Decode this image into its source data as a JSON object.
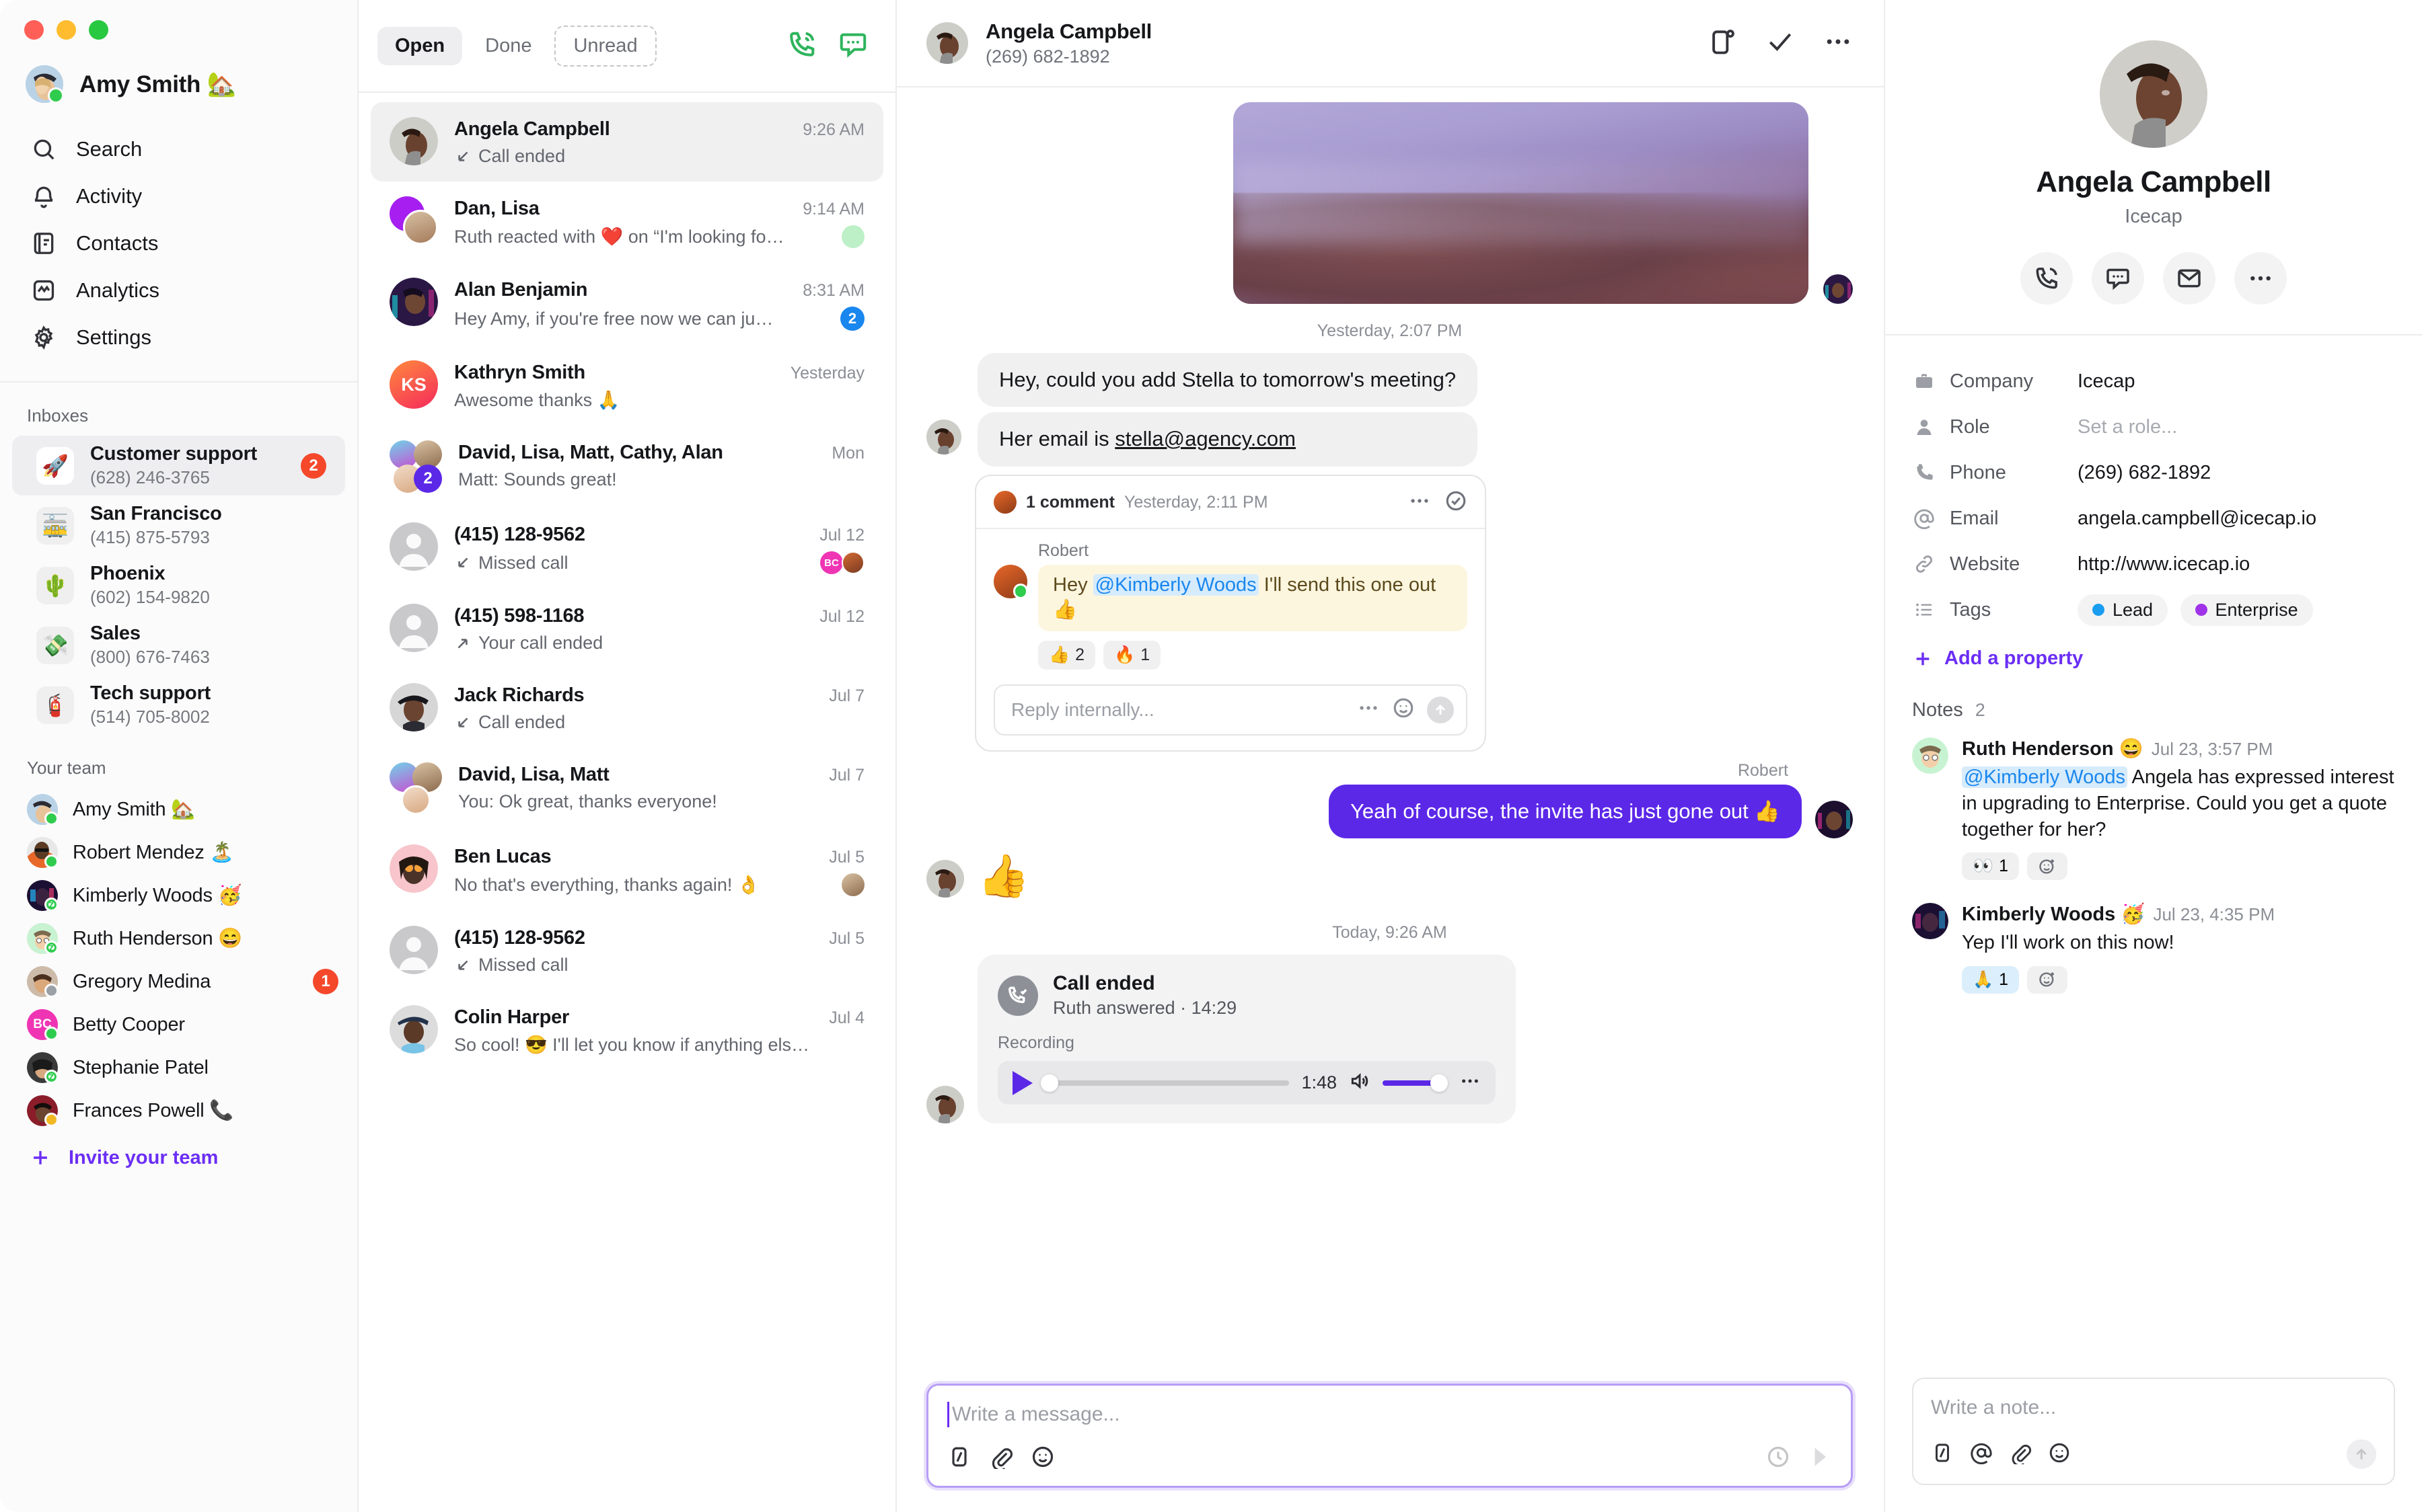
{
  "window": {
    "traffic_lights": [
      "close",
      "minimize",
      "maximize"
    ]
  },
  "nav": {
    "user": {
      "name": "Amy Smith",
      "emoji": "🏡",
      "presence": "online"
    },
    "items": [
      {
        "label": "Search",
        "icon": "search-icon"
      },
      {
        "label": "Activity",
        "icon": "bell-icon"
      },
      {
        "label": "Contacts",
        "icon": "contacts-book-icon"
      },
      {
        "label": "Analytics",
        "icon": "analytics-icon"
      },
      {
        "label": "Settings",
        "icon": "gear-icon"
      }
    ],
    "inboxes_title": "Inboxes",
    "inboxes": [
      {
        "name": "Customer support",
        "phone": "(628) 246-3765",
        "emoji": "🚀",
        "badge": "2",
        "selected": true
      },
      {
        "name": "San Francisco",
        "phone": "(415) 875-5793",
        "emoji": "🚋",
        "badge": "",
        "selected": false
      },
      {
        "name": "Phoenix",
        "phone": "(602) 154-9820",
        "emoji": "🌵",
        "badge": "",
        "selected": false
      },
      {
        "name": "Sales",
        "phone": "(800) 676-7463",
        "emoji": "💸",
        "badge": "",
        "selected": false
      },
      {
        "name": "Tech support",
        "phone": "(514) 705-8002",
        "emoji": "🧯",
        "badge": "",
        "selected": false
      }
    ],
    "team_title": "Your team",
    "team": [
      {
        "name": "Amy Smith",
        "emoji": "🏡",
        "presence": "online",
        "badge": ""
      },
      {
        "name": "Robert Mendez",
        "emoji": "🏝️",
        "presence": "online",
        "badge": ""
      },
      {
        "name": "Kimberly Woods",
        "emoji": "🥳",
        "presence": "snooze",
        "badge": ""
      },
      {
        "name": "Ruth Henderson",
        "emoji": "😄",
        "presence": "snooze",
        "badge": ""
      },
      {
        "name": "Gregory Medina",
        "emoji": "",
        "presence": "dnd",
        "badge": "1"
      },
      {
        "name": "Betty Cooper",
        "emoji": "",
        "presence": "online",
        "badge": "",
        "initials": "BC"
      },
      {
        "name": "Stephanie Patel",
        "emoji": "",
        "presence": "snooze",
        "badge": ""
      },
      {
        "name": "Frances Powell",
        "emoji": "📞",
        "presence": "away",
        "badge": ""
      }
    ],
    "invite_label": "Invite your team"
  },
  "conversation_list": {
    "tabs": [
      {
        "label": "Open",
        "active": true
      },
      {
        "label": "Done",
        "active": false
      },
      {
        "label": "Unread",
        "active": false,
        "dashed": true
      }
    ],
    "actions": [
      {
        "name": "new-call-icon"
      },
      {
        "name": "new-message-icon"
      }
    ],
    "items": [
      {
        "name": "Angela Campbell",
        "time": "9:26 AM",
        "preview": "Call ended",
        "call": "in",
        "selected": true,
        "badge": "",
        "avatar_type": "photo-angela"
      },
      {
        "name": "Dan, Lisa",
        "time": "9:14 AM",
        "preview": "Ruth reacted with ❤️ on “I'm looking fo…",
        "call": "",
        "selected": false,
        "badge": "",
        "avatar_type": "group2-dan-lisa",
        "trailing_avatar": true
      },
      {
        "name": "Alan Benjamin",
        "time": "8:31 AM",
        "preview": "Hey Amy, if you're free now we can ju…",
        "call": "",
        "selected": false,
        "badge": "2",
        "avatar_type": "photo-alan"
      },
      {
        "name": "Kathryn Smith",
        "time": "Yesterday",
        "preview": "Awesome thanks 🙏",
        "call": "",
        "selected": false,
        "badge": "",
        "avatar_type": "initials-KS"
      },
      {
        "name": "David, Lisa, Matt, Cathy, Alan",
        "time": "Mon",
        "preview": "Matt: Sounds great!",
        "call": "",
        "selected": false,
        "badge": "",
        "avatar_type": "group4-plus2",
        "group_count": "2"
      },
      {
        "name": "(415) 128-9562",
        "time": "Jul 12",
        "preview": "Missed call",
        "call": "in",
        "selected": false,
        "badge": "",
        "avatar_type": "anon",
        "trailing_stack": true
      },
      {
        "name": "(415) 598-1168",
        "time": "Jul 12",
        "preview": "Your call ended",
        "call": "out",
        "selected": false,
        "badge": "",
        "avatar_type": "anon"
      },
      {
        "name": "Jack Richards",
        "time": "Jul 7",
        "preview": "Call ended",
        "call": "in",
        "selected": false,
        "badge": "",
        "avatar_type": "photo-jack"
      },
      {
        "name": "David, Lisa, Matt",
        "time": "Jul 7",
        "preview": "You: Ok great, thanks everyone!",
        "call": "",
        "selected": false,
        "badge": "",
        "avatar_type": "group3"
      },
      {
        "name": "Ben Lucas",
        "time": "Jul 5",
        "preview": "No that's everything, thanks again! 👌",
        "call": "",
        "selected": false,
        "badge": "",
        "avatar_type": "memoji-ben",
        "trailing_avatar": true
      },
      {
        "name": "(415) 128-9562",
        "time": "Jul 5",
        "preview": "Missed call",
        "call": "in",
        "selected": false,
        "badge": "",
        "avatar_type": "anon"
      },
      {
        "name": "Colin Harper",
        "time": "Jul 4",
        "preview": "So cool! 😎 I'll let you know if anything els…",
        "call": "",
        "selected": false,
        "badge": "",
        "avatar_type": "photo-colin"
      }
    ]
  },
  "thread": {
    "header": {
      "name": "Angela Campbell",
      "phone": "(269) 682-1892",
      "actions": [
        "contact-card-icon",
        "mark-done-icon",
        "more-icon"
      ]
    },
    "image_message": {
      "alt": "purple misty mountains photo"
    },
    "separators": {
      "first": "Yesterday, 2:07 PM",
      "second": "Today, 9:26 AM"
    },
    "messages": [
      {
        "dir": "in",
        "text": "Hey, could you add Stella to tomorrow's meeting?"
      },
      {
        "dir": "in",
        "text": "Her email is ",
        "link": "stella@agency.com"
      }
    ],
    "comment": {
      "count_label": "1 comment",
      "time": "Yesterday, 2:11 PM",
      "author": "Robert",
      "text_pre": "Hey ",
      "mention": "@Kimberly Woods",
      "text_post": " I'll send this one out 👍",
      "reactions": [
        {
          "emoji": "👍",
          "count": "2"
        },
        {
          "emoji": "🔥",
          "count": "1"
        }
      ],
      "reply_placeholder": "Reply internally..."
    },
    "outgoing": {
      "sender": "Robert",
      "text": "Yeah of course, the invite has just gone out 👍"
    },
    "reaction_message": {
      "emoji": "👍"
    },
    "call_card": {
      "title": "Call ended",
      "subtitle": "Ruth answered · 14:29",
      "recording_label": "Recording",
      "duration": "1:48",
      "progress_percent": 0,
      "volume_percent": 82
    },
    "composer": {
      "placeholder": "Write a message...",
      "tools": [
        "snippet-icon",
        "attachment-icon",
        "emoji-icon"
      ],
      "right_tools": [
        "schedule-clock-icon",
        "send-icon"
      ]
    }
  },
  "right_panel": {
    "name": "Angela Campbell",
    "company_sub": "Icecap",
    "actions": [
      "call-icon",
      "message-icon",
      "email-icon",
      "more-icon"
    ],
    "properties": [
      {
        "icon": "briefcase-icon",
        "label": "Company",
        "value": "Icecap",
        "muted": false
      },
      {
        "icon": "person-icon",
        "label": "Role",
        "value": "Set a role...",
        "muted": true
      },
      {
        "icon": "phone-icon",
        "label": "Phone",
        "value": "(269) 682-1892",
        "muted": false
      },
      {
        "icon": "at-icon",
        "label": "Email",
        "value": "angela.campbell@icecap.io",
        "muted": false
      },
      {
        "icon": "link-icon",
        "label": "Website",
        "value": "http://www.icecap.io",
        "muted": false
      }
    ],
    "tags_label": "Tags",
    "tags": [
      {
        "label": "Lead",
        "color": "#1a9df0"
      },
      {
        "label": "Enterprise",
        "color": "#a033e8"
      }
    ],
    "add_property_label": "Add a property",
    "notes_title": "Notes",
    "notes_count": "2",
    "notes": [
      {
        "author": "Ruth Henderson",
        "emoji": "😄",
        "time": "Jul 23, 3:57 PM",
        "mention": "@Kimberly Woods",
        "text": " Angela has expressed interest in upgrading to Enterprise. Could you get a quote together for her?",
        "reactions": [
          {
            "emoji": "👀",
            "count": "1"
          }
        ]
      },
      {
        "author": "Kimberly Woods",
        "emoji": "🥳",
        "time": "Jul 23, 4:35 PM",
        "mention": "",
        "text": "Yep I'll work on this now!",
        "reactions": [
          {
            "emoji": "🙏",
            "count": "1"
          }
        ]
      }
    ],
    "note_composer": {
      "placeholder": "Write a note...",
      "tools": [
        "snippet-icon",
        "mention-icon",
        "attachment-icon",
        "emoji-icon"
      ]
    }
  },
  "colors": {
    "accent": "#5b28e8",
    "accent_link": "#6b2ef5",
    "badge_red": "#f5482b",
    "badge_blue": "#1a87ef",
    "green": "#2eb45c",
    "mention_blue": "#1a87ef"
  }
}
